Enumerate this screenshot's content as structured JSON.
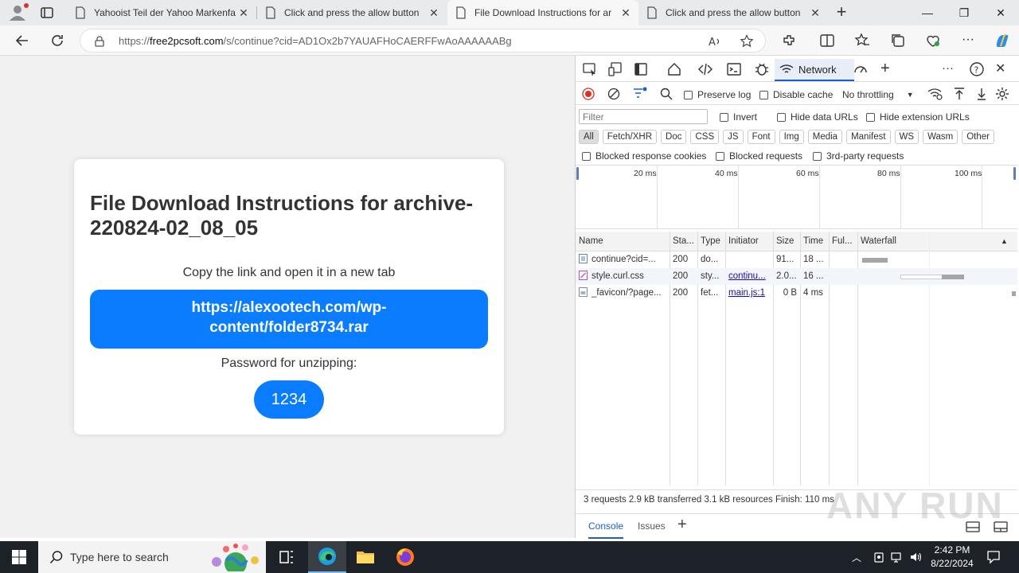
{
  "browser": {
    "tabs": [
      {
        "title": "Yahooist Teil der Yahoo Markenfa",
        "active": false
      },
      {
        "title": "Click and press the allow button",
        "active": false
      },
      {
        "title": "File Download Instructions for ar",
        "active": true
      },
      {
        "title": "Click and press the allow button",
        "active": false
      }
    ],
    "url_prefix": "https://",
    "url_domain": "free2pcsoft.com",
    "url_path": "/s/continue?cid=AD1Ox2b7YAUAFHoCAERFFwAoAAAAAABg"
  },
  "page": {
    "heading": "File Download Instructions for archive-220824-02_08_05",
    "copy_instruction": "Copy the link and open it in a new tab",
    "download_link": "https://alexootech.com/wp-content/folder8734.rar",
    "password_label": "Password for unzipping:",
    "password": "1234",
    "accent_color": "#0a7cff"
  },
  "devtools": {
    "active_panel": "Network",
    "toolbar": {
      "preserve_log": "Preserve log",
      "disable_cache": "Disable cache",
      "throttling": "No throttling"
    },
    "filter_placeholder": "Filter",
    "options": {
      "invert": "Invert",
      "hide_data_urls": "Hide data URLs",
      "hide_extension_urls": "Hide extension URLs",
      "blocked_response_cookies": "Blocked response cookies",
      "blocked_requests": "Blocked requests",
      "third_party_requests": "3rd-party requests"
    },
    "type_filters": [
      "All",
      "Fetch/XHR",
      "Doc",
      "CSS",
      "JS",
      "Font",
      "Img",
      "Media",
      "Manifest",
      "WS",
      "Wasm",
      "Other"
    ],
    "timeline_ticks": [
      "20 ms",
      "40 ms",
      "60 ms",
      "80 ms",
      "100 ms"
    ],
    "columns": [
      "Name",
      "Sta...",
      "Type",
      "Initiator",
      "Size",
      "Time",
      "Ful...",
      "Waterfall"
    ],
    "requests": [
      {
        "name": "continue?cid=...",
        "status": "200",
        "type": "do...",
        "initiator": "",
        "size": "91...",
        "time": "18 ...",
        "icon": "document-icon"
      },
      {
        "name": "style.curl.css",
        "status": "200",
        "type": "sty...",
        "initiator": "continu...",
        "size": "2.0...",
        "time": "16 ...",
        "icon": "stylesheet-icon"
      },
      {
        "name": "_favicon/?page...",
        "status": "200",
        "type": "fet...",
        "initiator": "main.js:1",
        "size": "0 B",
        "time": "4 ms",
        "icon": "fetch-icon"
      }
    ],
    "summary": "3 requests  2.9 kB transferred  3.1 kB resources  Finish: 110 ms",
    "drawer_tabs": [
      "Console",
      "Issues"
    ]
  },
  "taskbar": {
    "search_placeholder": "Type here to search",
    "time": "2:42 PM",
    "date": "8/22/2024"
  },
  "watermark": "ANY RUN"
}
